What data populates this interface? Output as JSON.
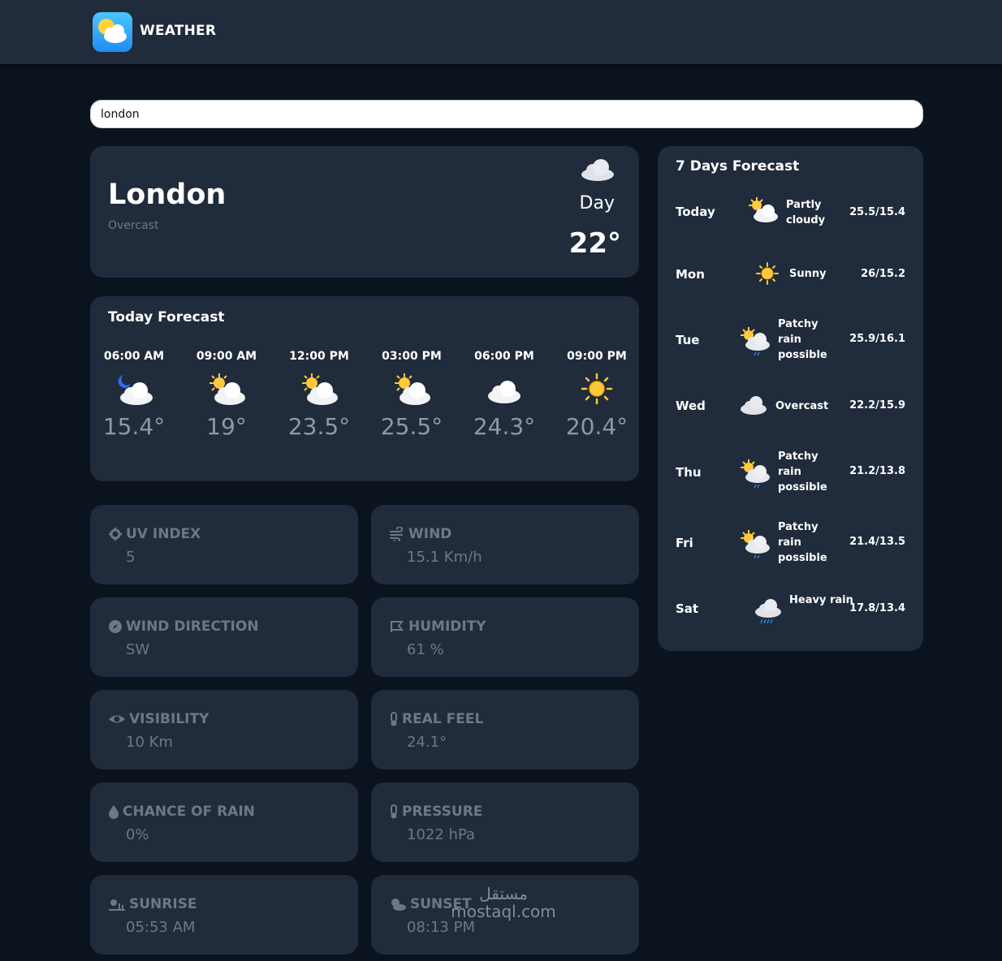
{
  "app": {
    "title": "WEATHER",
    "logo": "weather-logo-icon"
  },
  "search": {
    "value": "london"
  },
  "current": {
    "city": "London",
    "condition": "Overcast",
    "daypart": "Day",
    "temp": "22°",
    "icon": "cloud-icon"
  },
  "today_forecast": {
    "title": "Today Forecast",
    "hours": [
      {
        "time": "06:00 AM",
        "temp": "15.4°",
        "icon": "moon-cloud-icon"
      },
      {
        "time": "09:00 AM",
        "temp": "19°",
        "icon": "sun-cloud-icon"
      },
      {
        "time": "12:00 PM",
        "temp": "23.5°",
        "icon": "sun-cloud-icon"
      },
      {
        "time": "03:00 PM",
        "temp": "25.5°",
        "icon": "sun-cloud-icon"
      },
      {
        "time": "06:00 PM",
        "temp": "24.3°",
        "icon": "cloud-icon"
      },
      {
        "time": "09:00 PM",
        "temp": "20.4°",
        "icon": "sun-icon"
      }
    ]
  },
  "stats": [
    {
      "label": "UV INDEX",
      "value": "5",
      "icon": "gear-icon"
    },
    {
      "label": "WIND",
      "value": "15.1 Km/h",
      "icon": "wind-icon"
    },
    {
      "label": "WIND DIRECTION",
      "value": "SW",
      "icon": "compass-icon"
    },
    {
      "label": "HUMIDITY",
      "value": "61 %",
      "icon": "humidity-icon"
    },
    {
      "label": "VISIBILITY",
      "value": "10 Km",
      "icon": "eye-icon"
    },
    {
      "label": "REAL FEEL",
      "value": "24.1°",
      "icon": "thermometer-icon"
    },
    {
      "label": "CHANCE OF RAIN",
      "value": "0%",
      "icon": "droplet-icon"
    },
    {
      "label": "PRESSURE",
      "value": "1022 hPa",
      "icon": "thermometer-icon"
    },
    {
      "label": "SUNRISE",
      "value": "05:53 AM",
      "icon": "sunrise-icon"
    },
    {
      "label": "SUNSET",
      "value": "08:13 PM",
      "icon": "sunset-icon"
    }
  ],
  "week_forecast": {
    "title": "7 Days Forecast",
    "days": [
      {
        "day": "Today",
        "condition": "Partly cloudy",
        "range": "25.5/15.4",
        "icon": "sun-cloud-icon"
      },
      {
        "day": "Mon",
        "condition": "Sunny",
        "range": "26/15.2",
        "icon": "sun-icon"
      },
      {
        "day": "Tue",
        "condition": "Patchy rain possible",
        "range": "25.9/16.1",
        "icon": "sun-rain-icon"
      },
      {
        "day": "Wed",
        "condition": "Overcast",
        "range": "22.2/15.9",
        "icon": "cloud-icon"
      },
      {
        "day": "Thu",
        "condition": "Patchy rain possible",
        "range": "21.2/13.8",
        "icon": "sun-rain-icon"
      },
      {
        "day": "Fri",
        "condition": "Patchy rain possible",
        "range": "21.4/13.5",
        "icon": "sun-rain-icon"
      },
      {
        "day": "Sat",
        "condition": "Heavy rain",
        "range": "17.8/13.4",
        "icon": "heavy-rain-icon"
      }
    ]
  },
  "watermark": {
    "text": "مستقل mostaql.com"
  },
  "colors": {
    "background": "#0b131e",
    "card": "#202b3b",
    "muted_text": "#6e7885",
    "sun": "#ffc93c"
  }
}
